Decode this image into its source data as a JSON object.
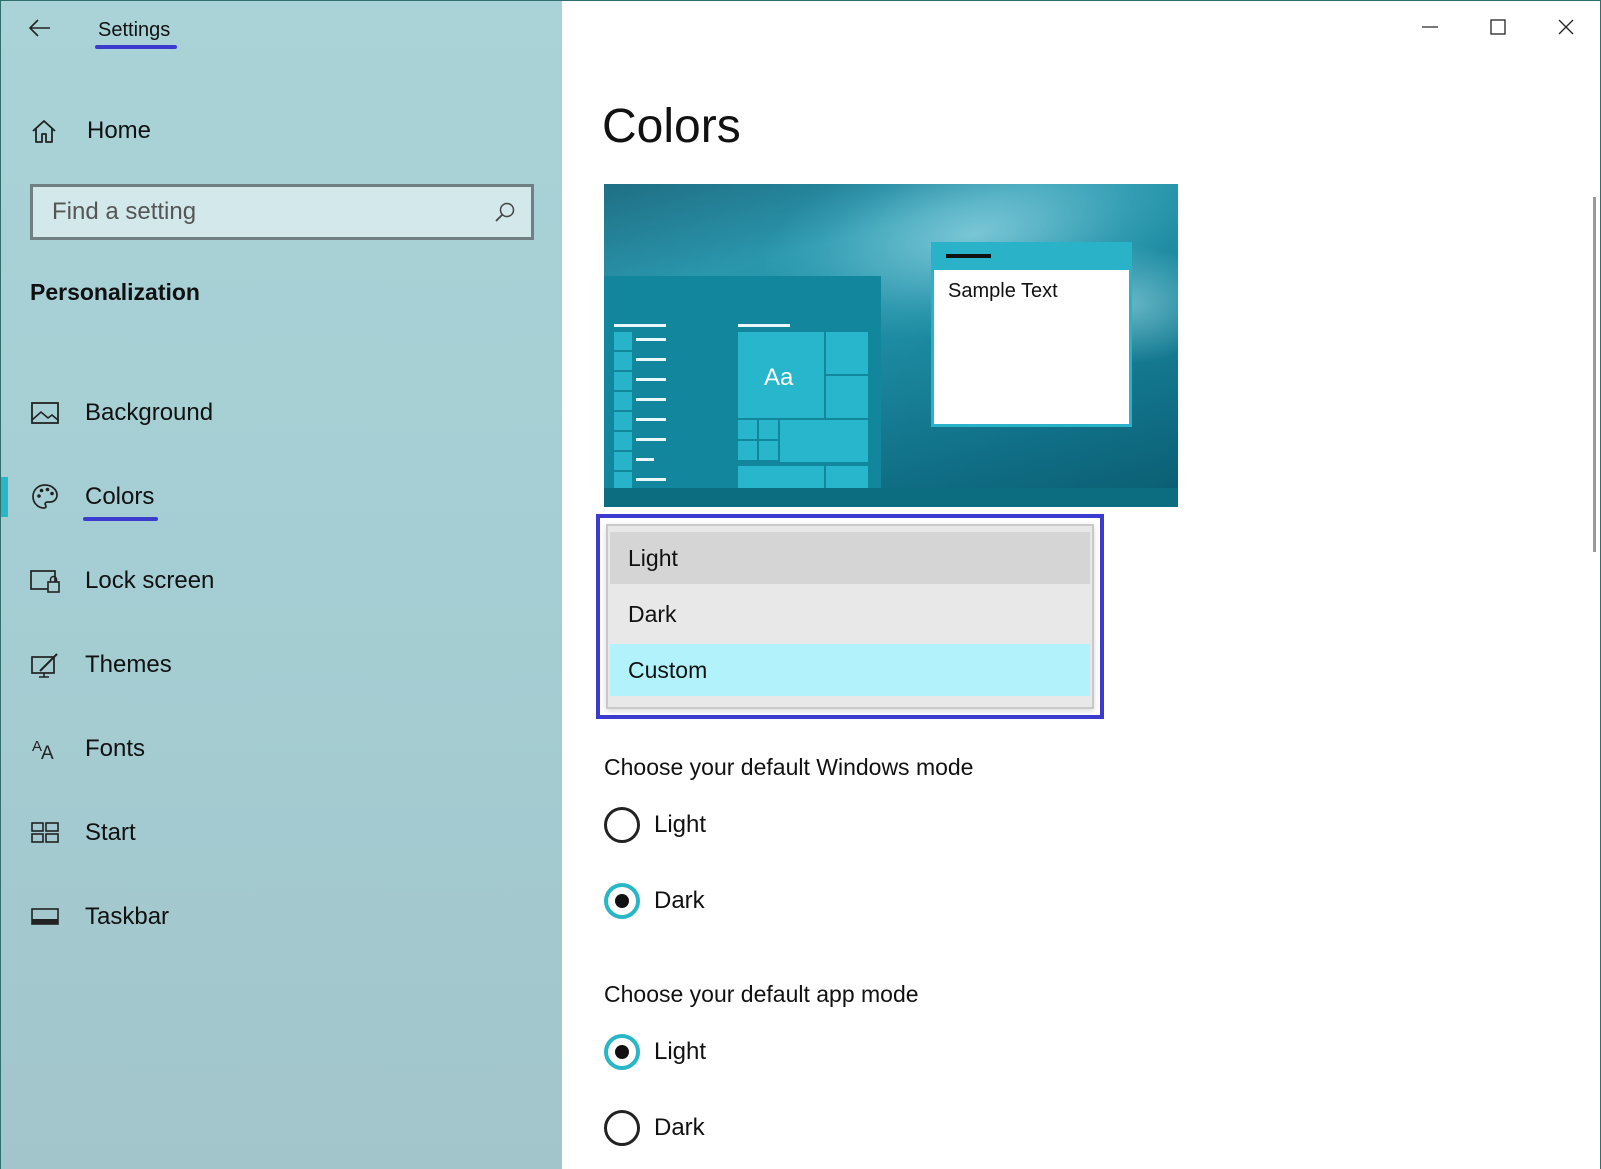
{
  "window": {
    "title": "Settings",
    "controls": [
      "minimize",
      "maximize",
      "close"
    ]
  },
  "sidebar": {
    "home_label": "Home",
    "search": {
      "placeholder": "Find a setting"
    },
    "section_title": "Personalization",
    "items": [
      {
        "label": "Background",
        "icon": "picture-icon",
        "active": false
      },
      {
        "label": "Colors",
        "icon": "palette-icon",
        "active": true
      },
      {
        "label": "Lock screen",
        "icon": "lock-screen-icon",
        "active": false
      },
      {
        "label": "Themes",
        "icon": "brush-icon",
        "active": false
      },
      {
        "label": "Fonts",
        "icon": "fonts-icon",
        "active": false
      },
      {
        "label": "Start",
        "icon": "start-icon",
        "active": false
      },
      {
        "label": "Taskbar",
        "icon": "taskbar-icon",
        "active": false
      }
    ]
  },
  "main": {
    "title": "Colors",
    "preview": {
      "tile_label": "Aa",
      "sample_text": "Sample Text"
    },
    "color_dropdown": {
      "options": [
        "Light",
        "Dark",
        "Custom"
      ],
      "hovered": "Light",
      "selected": "Custom"
    },
    "windows_mode": {
      "label": "Choose your default Windows mode",
      "options": [
        "Light",
        "Dark"
      ],
      "selected": "Dark"
    },
    "app_mode": {
      "label": "Choose your default app mode",
      "options": [
        "Light",
        "Dark"
      ],
      "selected": "Light"
    }
  },
  "colors": {
    "accent": "#29b6c7",
    "highlight_annotation": "#3b3ccf",
    "selected_option_bg": "#b2f3fb"
  }
}
